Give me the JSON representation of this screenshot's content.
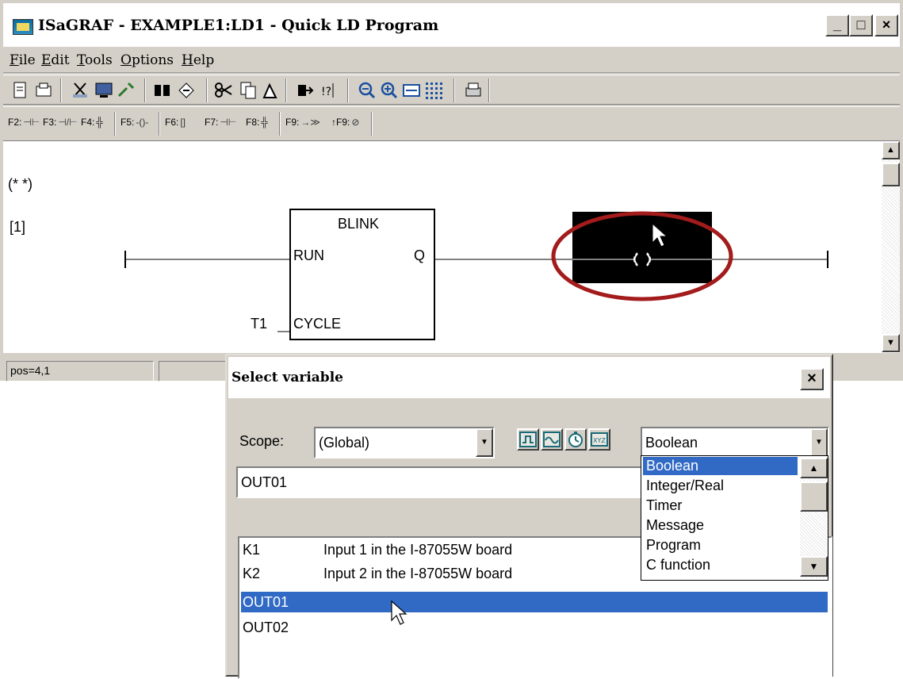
{
  "window": {
    "title": "ISaGRAF - EXAMPLE1:LD1 - Quick LD Program",
    "minimize": "_",
    "maximize": "□",
    "close": "×"
  },
  "menu": [
    "File",
    "Edit",
    "Tools",
    "Options",
    "Help"
  ],
  "fkeys": [
    {
      "key": "F2:",
      "symbol": "⊣⊢"
    },
    {
      "key": "F3:",
      "symbol": "⊣/⊢"
    },
    {
      "key": "F4:",
      "symbol": "╬"
    },
    {
      "key": "F5:",
      "symbol": "-()-"
    },
    {
      "key": "F6:",
      "symbol": "[]"
    },
    {
      "key": "F7:",
      "symbol": "⊣⊢"
    },
    {
      "key": "F8:",
      "symbol": "╬"
    },
    {
      "key": "F9:",
      "symbol": "→≫"
    },
    {
      "key": "↑F9:",
      "symbol": "⊘"
    }
  ],
  "editor": {
    "comment": "(*  *)",
    "rung_label": "[1]",
    "block_name": "BLINK",
    "pin_run": "RUN",
    "pin_q": "Q",
    "pin_cycle": "CYCLE",
    "cycle_var": "T1"
  },
  "status": {
    "position": "pos=4,1"
  },
  "dialog": {
    "title": "Select variable",
    "close": "×",
    "scope_label": "Scope:",
    "scope_value": "(Global)",
    "type_value": "Boolean",
    "name_input": "OUT01",
    "type_options": [
      "Boolean",
      "Integer/Real",
      "Timer",
      "Message",
      "Program",
      "C function"
    ],
    "variables": [
      {
        "name": "K1",
        "desc": "Input 1 in the I-87055W board"
      },
      {
        "name": "K2",
        "desc": "Input 2 in the I-87055W board"
      },
      {
        "name": "OUT01",
        "desc": ""
      },
      {
        "name": "OUT02",
        "desc": ""
      }
    ]
  },
  "colors": {
    "selection": "#316ac5",
    "highlight_circle": "#a31b1b",
    "chrome": "#d4d0c8"
  }
}
